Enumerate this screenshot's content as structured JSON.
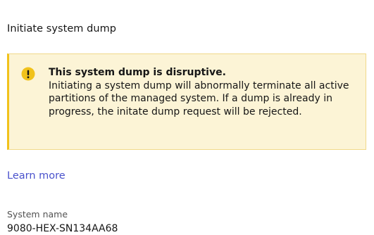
{
  "page": {
    "title": "Initiate system dump"
  },
  "alert": {
    "icon": "warning-icon",
    "color": "#f1c21b",
    "background": "#fcf4d6",
    "title": "This system dump is disruptive.",
    "body": "Initiating a system dump will abnormally terminate all active partitions of the managed system. If a dump is already in progress, the initate dump request will be rejected."
  },
  "links": {
    "learn_more": "Learn more"
  },
  "fields": {
    "system_name": {
      "label": "System name",
      "value": "9080-HEX-SN134AA68"
    }
  }
}
